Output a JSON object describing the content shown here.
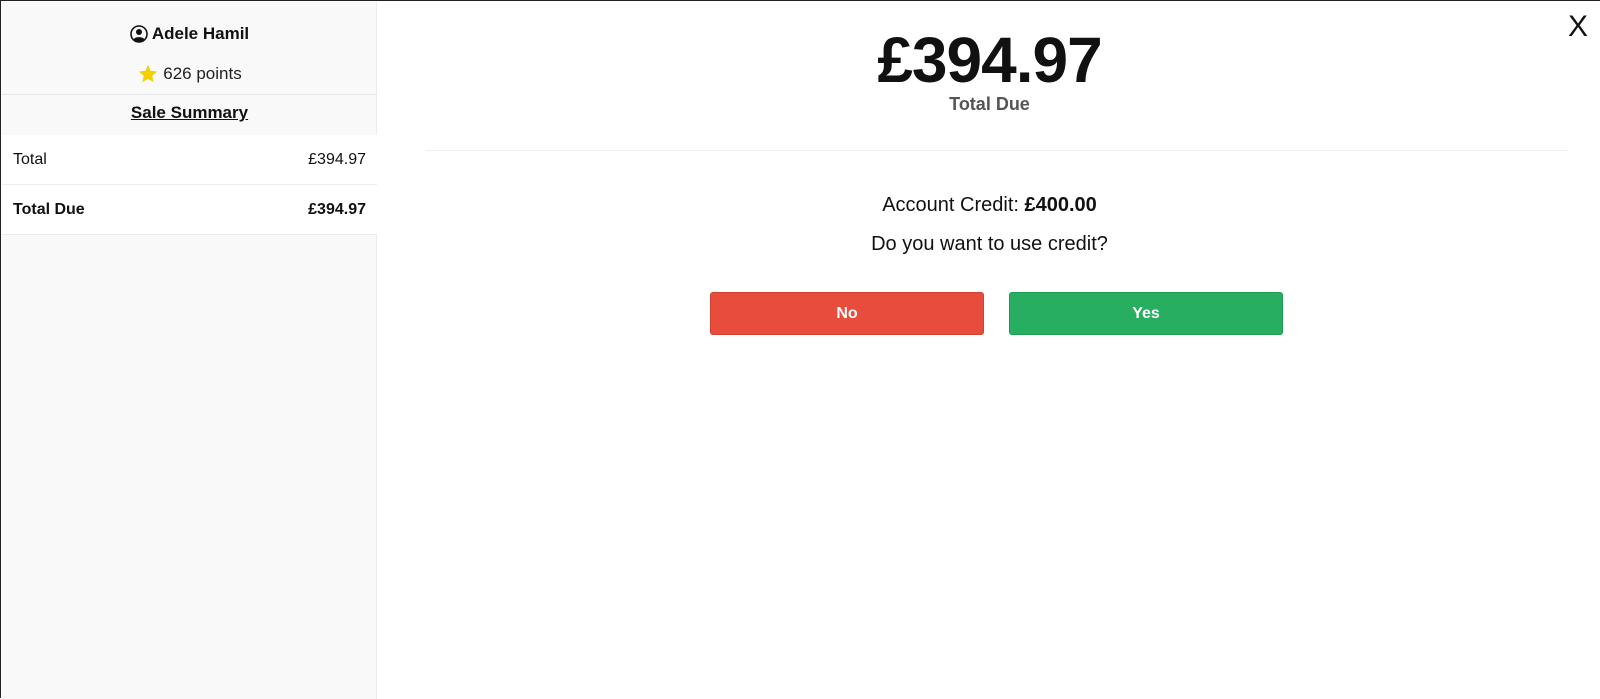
{
  "customer": {
    "name": "Adele Hamil",
    "points_label": "626 points"
  },
  "summary": {
    "title": "Sale Summary",
    "rows": [
      {
        "label": "Total",
        "value": "£394.97"
      },
      {
        "label": "Total Due",
        "value": "£394.97"
      }
    ]
  },
  "payment": {
    "amount": "£394.97",
    "amount_label": "Total Due",
    "credit_prefix": "Account Credit: ",
    "credit_value": "£400.00",
    "question": "Do you want to use credit?",
    "no_label": "No",
    "yes_label": "Yes",
    "close_label": "X"
  },
  "colors": {
    "no_button": "#e74c3c",
    "yes_button": "#27ae60",
    "star": "#f5d000"
  },
  "icons": {
    "user": "user-circle-icon",
    "star": "star-icon"
  }
}
